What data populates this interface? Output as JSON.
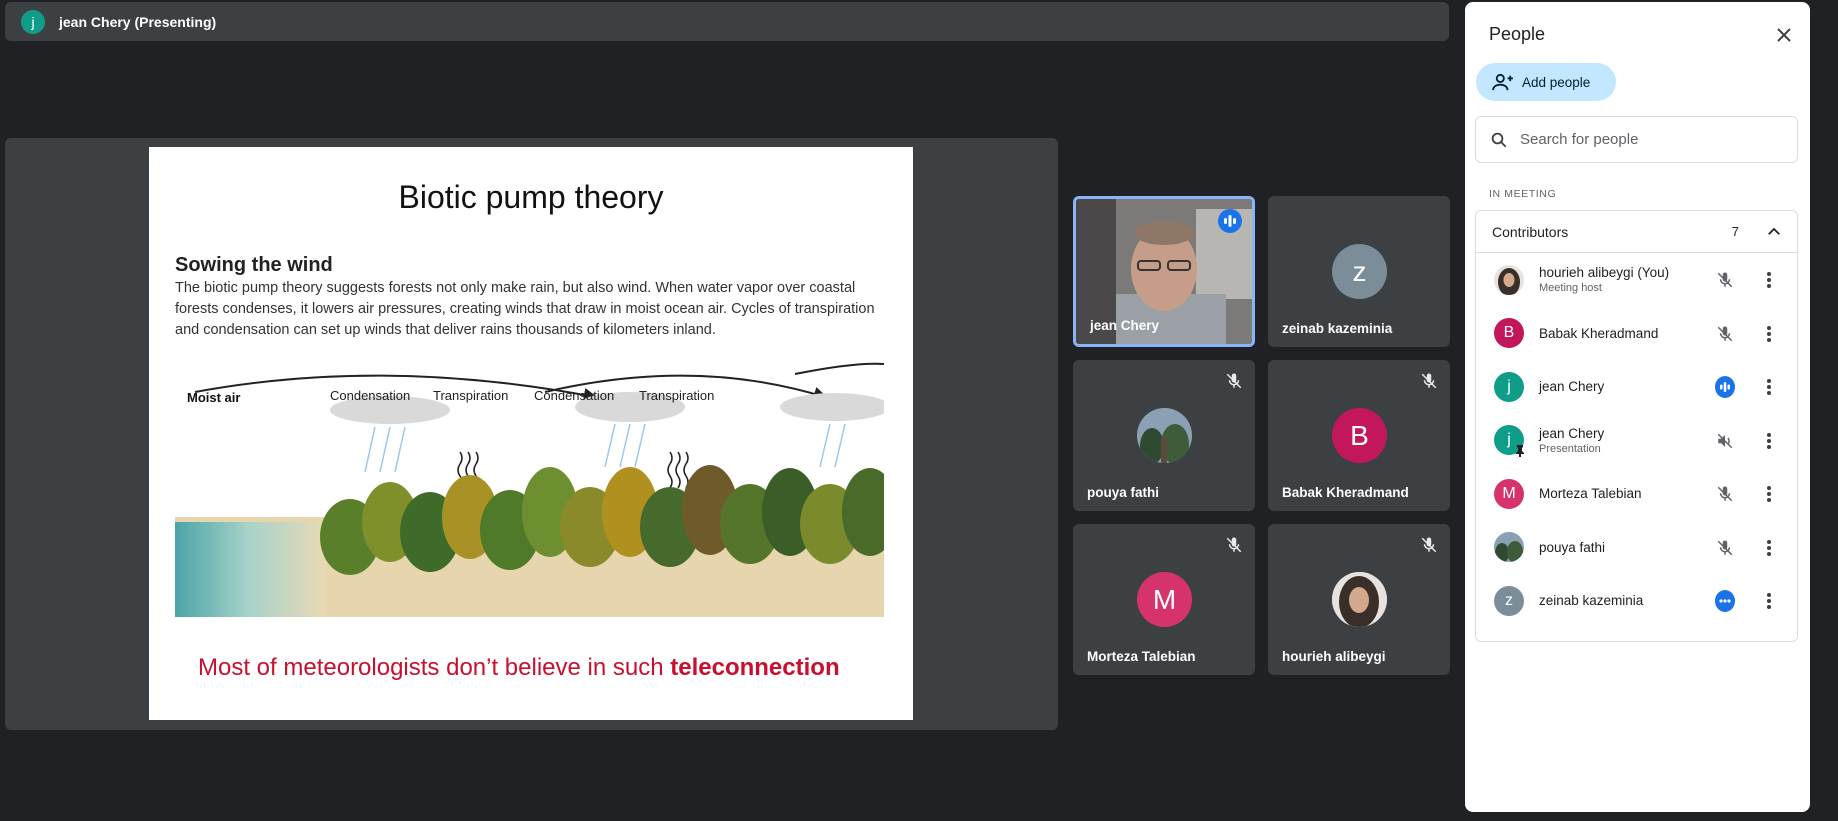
{
  "topbar": {
    "avatar_letter": "j",
    "title": "jean Chery (Presenting)"
  },
  "slide": {
    "title": "Biotic pump theory",
    "subtitle": "Sowing the wind",
    "body": "The biotic pump theory suggests forests not only make rain, but also wind. When water vapor over coastal forests condenses, it lowers air pressures, creating winds that draw in moist ocean air. Cycles of transpiration and condensation can set up winds that deliver rains thousands of kilometers inland.",
    "labels": {
      "moist_air": "Moist air",
      "condensation": "Condensation",
      "transpiration": "Transpiration"
    },
    "footer_text": "Most of meteorologists don’t believe in such ",
    "footer_bold": "teleconnection"
  },
  "tiles": [
    {
      "name": "jean Chery",
      "type": "video",
      "speaking": true
    },
    {
      "name": "zeinab kazeminia",
      "letter": "z",
      "color": "#7b8d99"
    },
    {
      "name": "pouya fathi",
      "type": "photo-trees",
      "muted": true
    },
    {
      "name": "Babak Kheradmand",
      "letter": "B",
      "color": "#c2185b",
      "muted": true
    },
    {
      "name": "Morteza Talebian",
      "letter": "M",
      "color": "#d6336c",
      "muted": true
    },
    {
      "name": "hourieh alibeygi",
      "type": "photo-person",
      "muted": true
    }
  ],
  "panel": {
    "title": "People",
    "add_label": "Add people",
    "search_placeholder": "Search for people",
    "section_label": "IN MEETING",
    "group_label": "Contributors",
    "group_count": "7",
    "people": [
      {
        "name": "hourieh alibeygi (You)",
        "note": "Meeting host",
        "avatar": "photo-person",
        "mic": "muted"
      },
      {
        "name": "Babak Kheradmand",
        "note": "",
        "letter": "B",
        "color": "#c2185b",
        "mic": "muted"
      },
      {
        "name": "jean Chery",
        "note": "",
        "letter": "j",
        "color": "#0f9d8a",
        "mic": "speaking"
      },
      {
        "name": "jean Chery",
        "note": "Presentation",
        "letter": "j",
        "color": "#0f9d8a",
        "mic": "audio-off"
      },
      {
        "name": "Morteza Talebian",
        "note": "",
        "letter": "M",
        "color": "#d6336c",
        "mic": "muted"
      },
      {
        "name": "pouya fathi",
        "note": "",
        "avatar": "photo-trees",
        "mic": "muted"
      },
      {
        "name": "zeinab kazeminia",
        "note": "",
        "letter": "z",
        "color": "#7b8d99",
        "mic": "more"
      }
    ]
  }
}
